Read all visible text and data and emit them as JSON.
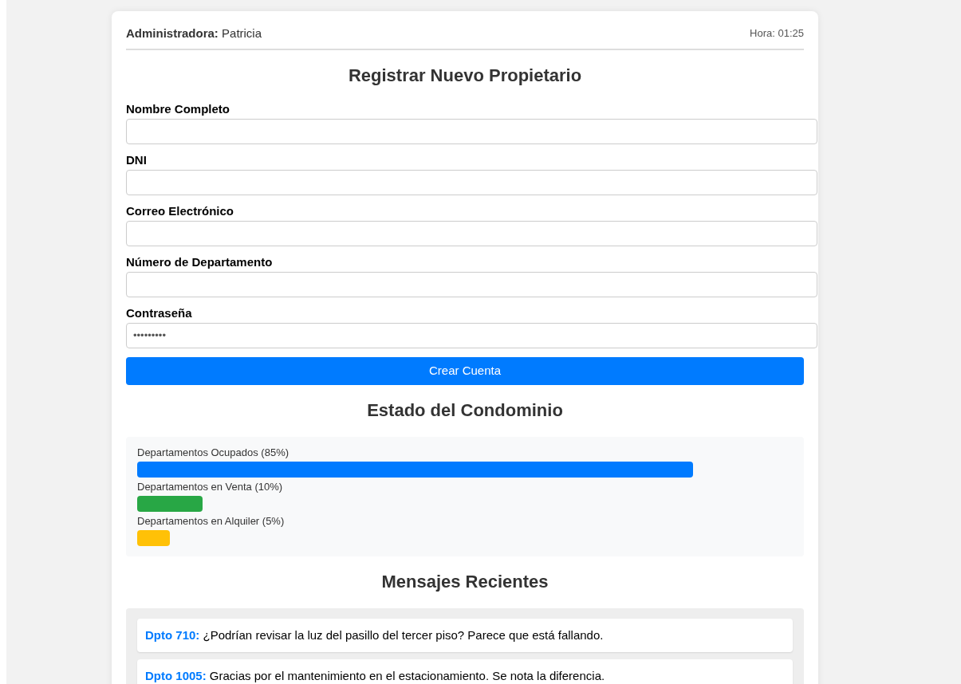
{
  "header": {
    "role_label": "Administradora:",
    "name": "Patricia",
    "time": "Hora: 01:25"
  },
  "form": {
    "title": "Registrar Nuevo Propietario",
    "fields": [
      {
        "label": "Nombre Completo"
      },
      {
        "label": "DNI"
      },
      {
        "label": "Correo Electrónico"
      },
      {
        "label": "Número de Departamento"
      },
      {
        "label": "Contraseña",
        "value": "•••••••••"
      }
    ],
    "submit": "Crear Cuenta"
  },
  "status": {
    "title": "Estado del Condominio",
    "bars": [
      {
        "label": "Departamentos Ocupados (85%)",
        "level": 0.85,
        "color": "#007bff"
      },
      {
        "label": "Departamentos en Venta (10%)",
        "level": 0.1,
        "color": "#28a745"
      },
      {
        "label": "Departamentos en Alquiler (5%)",
        "level": 0.05,
        "color": "#ffc107"
      }
    ]
  },
  "messages": {
    "title": "Mensajes Recientes",
    "items": [
      {
        "sender": "Dpto 710:",
        "text": "¿Podrían revisar la luz del pasillo del tercer piso? Parece que está fallando."
      },
      {
        "sender": "Dpto 1005:",
        "text": "Gracias por el mantenimiento en el estacionamiento. Se nota la diferencia."
      }
    ]
  }
}
